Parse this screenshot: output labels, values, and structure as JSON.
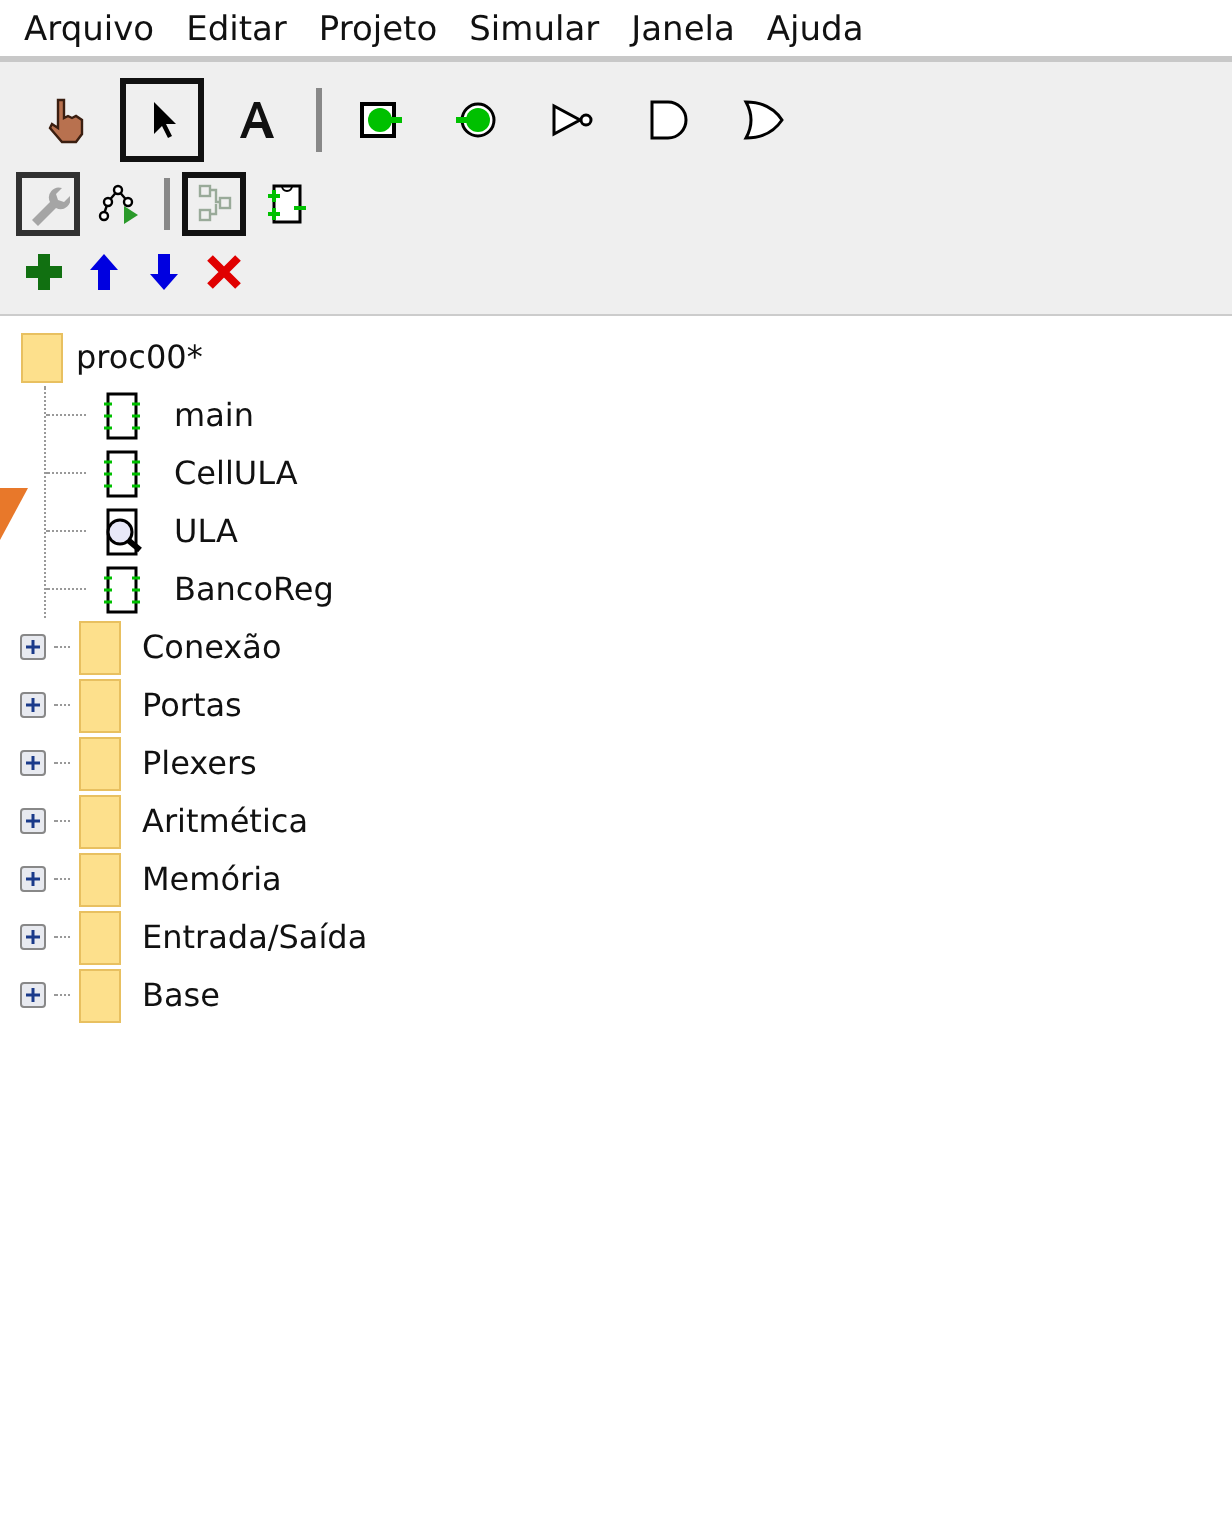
{
  "menu": [
    "Arquivo",
    "Editar",
    "Projeto",
    "Simular",
    "Janela",
    "Ajuda"
  ],
  "tool_bar": [
    {
      "kind": "poke",
      "selected": false
    },
    {
      "kind": "select",
      "selected": true
    },
    {
      "kind": "text",
      "selected": false
    },
    {
      "kind": "separator"
    },
    {
      "kind": "input-pin",
      "selected": false
    },
    {
      "kind": "output-pin",
      "selected": false
    },
    {
      "kind": "not-gate",
      "selected": false
    },
    {
      "kind": "and-gate",
      "selected": false
    },
    {
      "kind": "or-gate",
      "selected": false
    }
  ],
  "view_bar": [
    {
      "kind": "toolbox",
      "selected": true,
      "disabled": true
    },
    {
      "kind": "sim-tree",
      "selected": false,
      "disabled": false
    },
    {
      "kind": "separator"
    },
    {
      "kind": "layout",
      "selected": true,
      "disabled": false
    },
    {
      "kind": "appearance",
      "selected": false,
      "disabled": false
    }
  ],
  "project_bar": [
    {
      "kind": "add"
    },
    {
      "kind": "up"
    },
    {
      "kind": "down"
    },
    {
      "kind": "delete"
    }
  ],
  "tree": {
    "label": "proc00*",
    "children": [
      {
        "label": "main",
        "viewing": false
      },
      {
        "label": "CellULA",
        "viewing": false
      },
      {
        "label": "ULA",
        "viewing": true
      },
      {
        "label": "BancoReg",
        "viewing": false
      }
    ],
    "libraries": [
      {
        "label": "Conexão",
        "expanded": false
      },
      {
        "label": "Portas",
        "expanded": false
      },
      {
        "label": "Plexers",
        "expanded": false
      },
      {
        "label": "Aritmética",
        "expanded": false
      },
      {
        "label": "Memória",
        "expanded": false
      },
      {
        "label": "Entrada/Saída",
        "expanded": false
      },
      {
        "label": "Base",
        "expanded": false
      }
    ]
  }
}
